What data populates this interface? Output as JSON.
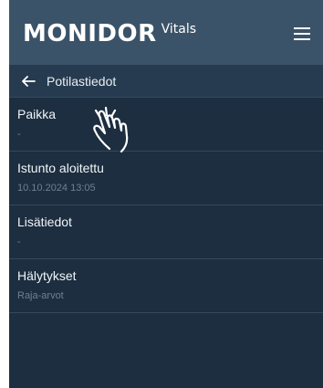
{
  "header": {
    "brand": "MONIDOR",
    "brand_sub": "Vitals",
    "menu_icon": "hamburger-menu-icon"
  },
  "subheader": {
    "back_icon": "arrow-left-icon",
    "title": "Potilastiedot"
  },
  "rows": [
    {
      "title": "Paikka",
      "value": "-"
    },
    {
      "title": "Istunto aloitettu",
      "value": "10.10.2024 13:05"
    },
    {
      "title": "Lisätiedot",
      "value": "-"
    },
    {
      "title": "Hälytykset",
      "value": "Raja-arvot"
    }
  ],
  "colors": {
    "topbar": "#3b5368",
    "background": "#1c2e40",
    "subheader": "#263b4f",
    "text_primary": "#f2f5f8",
    "text_secondary": "#6e8092"
  },
  "overlay": {
    "cursor_icon": "hand-pointer-icon"
  }
}
